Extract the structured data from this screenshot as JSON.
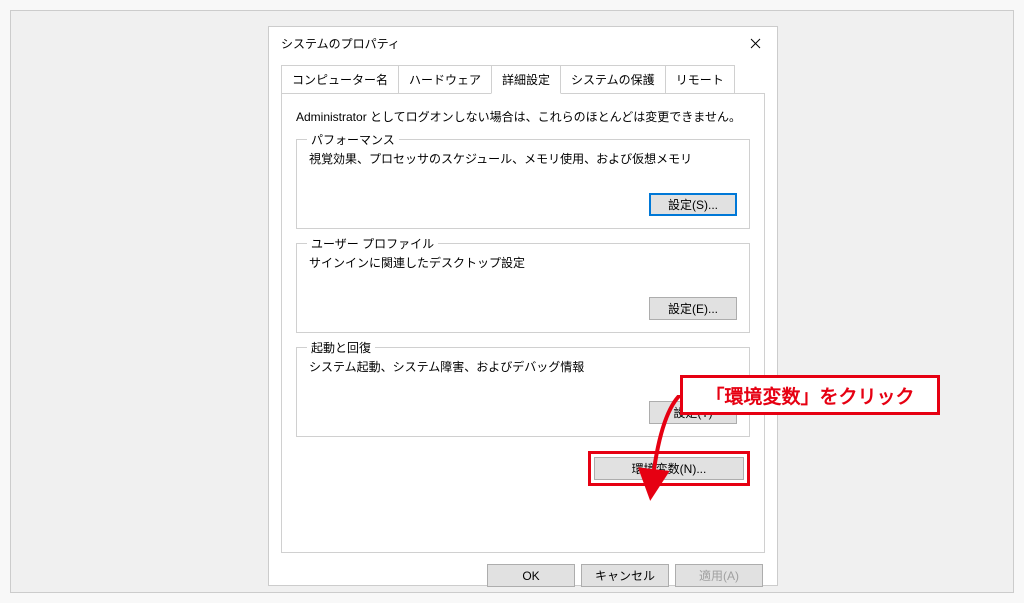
{
  "dialog": {
    "title": "システムのプロパティ",
    "tabs": {
      "computer_name": "コンピューター名",
      "hardware": "ハードウェア",
      "advanced": "詳細設定",
      "system_protection": "システムの保護",
      "remote": "リモート"
    },
    "note": "Administrator としてログオンしない場合は、これらのほとんどは変更できません。",
    "performance": {
      "legend": "パフォーマンス",
      "desc": "視覚効果、プロセッサのスケジュール、メモリ使用、および仮想メモリ",
      "button": "設定(S)..."
    },
    "user_profile": {
      "legend": "ユーザー プロファイル",
      "desc": "サインインに関連したデスクトップ設定",
      "button": "設定(E)..."
    },
    "startup": {
      "legend": "起動と回復",
      "desc": "システム起動、システム障害、およびデバッグ情報",
      "button": "設定(T)"
    },
    "env_button": "環境変数(N)...",
    "bottom": {
      "ok": "OK",
      "cancel": "キャンセル",
      "apply": "適用(A)"
    }
  },
  "callout": {
    "text": "「環境変数」をクリック"
  }
}
